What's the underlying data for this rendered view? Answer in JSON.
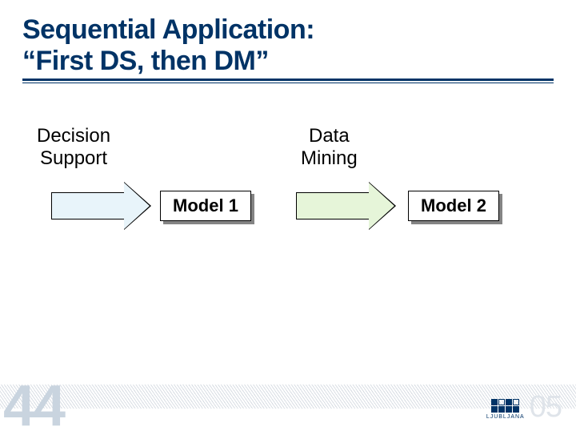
{
  "title": {
    "line1": "Sequential Application:",
    "line2": "“First DS, then DM”"
  },
  "diagram": {
    "label1": {
      "line1": "Decision",
      "line2": "Support"
    },
    "label2": {
      "line1": "Data",
      "line2": "Mining"
    },
    "box1": "Model 1",
    "box2": "Model 2"
  },
  "footer": {
    "page": "44",
    "logo_city": "LJUBLJANA",
    "logo_year": "05"
  }
}
